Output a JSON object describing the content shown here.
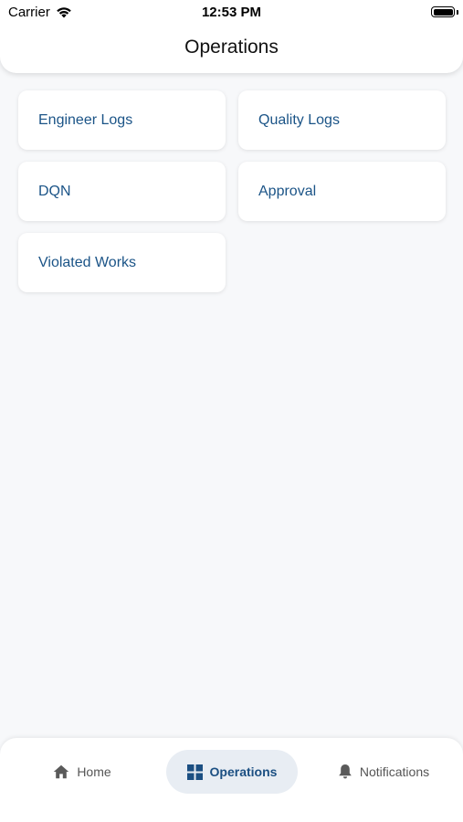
{
  "status_bar": {
    "carrier": "Carrier",
    "time": "12:53 PM",
    "icons": [
      "wifi-icon",
      "battery-icon"
    ]
  },
  "header": {
    "title": "Operations"
  },
  "cards": [
    {
      "label": "Engineer Logs"
    },
    {
      "label": "Quality Logs"
    },
    {
      "label": "DQN"
    },
    {
      "label": "Approval"
    },
    {
      "label": "Violated Works"
    }
  ],
  "bottom_nav": {
    "items": [
      {
        "label": "Home",
        "icon": "home-icon",
        "active": false
      },
      {
        "label": "Operations",
        "icon": "grid-icon",
        "active": true
      },
      {
        "label": "Notifications",
        "icon": "bell-icon",
        "active": false
      }
    ]
  },
  "colors": {
    "accent": "#1b5487",
    "background": "#f7f8fa",
    "active_tab_bg": "#e8edf3"
  }
}
